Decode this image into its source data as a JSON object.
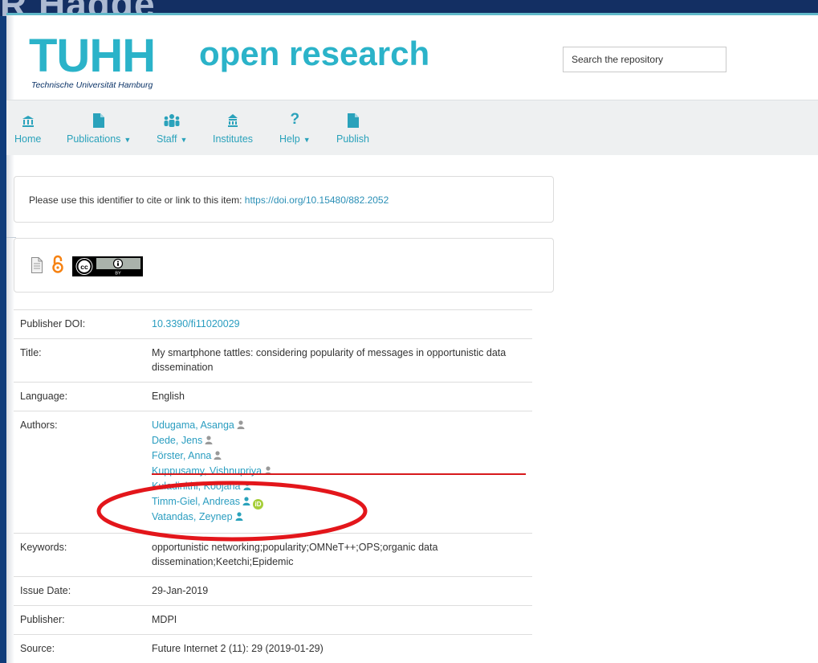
{
  "background": {
    "ghost_text": "R Hadge"
  },
  "header": {
    "logo_text": "TUHH",
    "logo_sub": "Technische Universität Hamburg",
    "site_title": "open research",
    "search_placeholder": "Search the repository"
  },
  "nav": {
    "items": [
      {
        "label": "Home",
        "icon": "bank-icon",
        "has_caret": false
      },
      {
        "label": "Publications",
        "icon": "document-icon",
        "has_caret": true
      },
      {
        "label": "Staff",
        "icon": "people-icon",
        "has_caret": true
      },
      {
        "label": "Institutes",
        "icon": "institution-icon",
        "has_caret": false
      },
      {
        "label": "Help",
        "icon": "question-icon",
        "has_caret": true
      },
      {
        "label": "Publish",
        "icon": "document-icon",
        "has_caret": false
      }
    ]
  },
  "cite": {
    "text": "Please use this identifier to cite or link to this item: ",
    "url": "https://doi.org/10.15480/882.2052"
  },
  "license": {
    "icons": [
      "document-icon",
      "open-access-icon",
      "cc-by-badge"
    ],
    "cc_text": "cc",
    "cc_by_text": "BY"
  },
  "metadata": {
    "publisher_doi": {
      "label": "Publisher DOI:",
      "value": "10.3390/fi11020029"
    },
    "title": {
      "label": "Title:",
      "value": "My smartphone tattles: considering popularity of messages in opportunistic data dissemination"
    },
    "language": {
      "label": "Language:",
      "value": "English"
    },
    "authors": {
      "label": "Authors:",
      "list": [
        {
          "name": "Udugama, Asanga",
          "orcid": false
        },
        {
          "name": "Dede, Jens",
          "orcid": false
        },
        {
          "name": "Förster, Anna",
          "orcid": false
        },
        {
          "name": "Kuppusamy, Vishnupriya",
          "orcid": false
        },
        {
          "name": "Kuladinithi, Koojana",
          "orcid": false
        },
        {
          "name": "Timm-Giel, Andreas",
          "orcid": true
        },
        {
          "name": "Vatandas, Zeynep",
          "orcid": false
        }
      ]
    },
    "keywords": {
      "label": "Keywords:",
      "value": "opportunistic networking;popularity;OMNeT++;OPS;organic data dissemination;Keetchi;Epidemic"
    },
    "issue_date": {
      "label": "Issue Date:",
      "value": "29-Jan-2019"
    },
    "publisher": {
      "label": "Publisher:",
      "value": "MDPI"
    },
    "source": {
      "label": "Source:",
      "value": "Future Internet 2 (11): 29 (2019-01-29)"
    }
  },
  "colors": {
    "accent": "#2bb3c9",
    "link": "#2a9dc0",
    "annotation": "#e3161b",
    "orcid": "#a6ce39"
  }
}
